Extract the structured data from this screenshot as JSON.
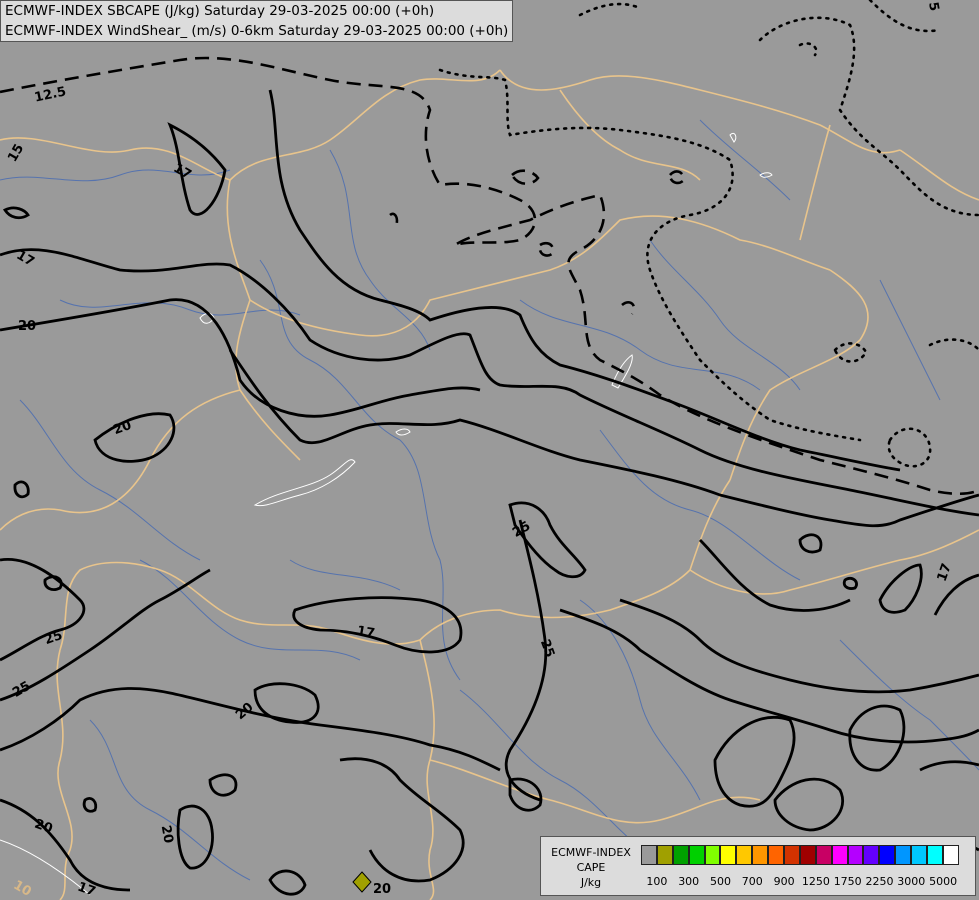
{
  "header": {
    "line1": "ECMWF-INDEX SBCAPE (J/kg) Saturday 29-03-2025 00:00 (+0h)",
    "line2": "ECMWF-INDEX WindShear_ (m/s) 0-6km Saturday 29-03-2025 00:00 (+0h)"
  },
  "legend": {
    "line1": "ECMWF-INDEX",
    "line2": "CAPE",
    "line3": "J/kg",
    "colors": [
      "#9a9a9a",
      "#a0a000",
      "#00a000",
      "#00d000",
      "#80ff00",
      "#ffff00",
      "#ffc800",
      "#ff9600",
      "#ff6400",
      "#d23200",
      "#a00000",
      "#c80064",
      "#ff00ff",
      "#b400ff",
      "#6400ff",
      "#0000ff",
      "#0096ff",
      "#00c8ff",
      "#00ffff",
      "#ffffff"
    ],
    "ticks": [
      "100",
      "300",
      "500",
      "700",
      "900",
      "1250",
      "1750",
      "2250",
      "3000",
      "5000"
    ]
  },
  "contour_labels": [
    "12.5",
    "15",
    "17",
    "17",
    "20",
    "20",
    "25",
    "25",
    "17",
    "25",
    "25",
    "17",
    "20",
    "20",
    "20",
    "17",
    "5",
    "10"
  ],
  "marker_label": "20"
}
